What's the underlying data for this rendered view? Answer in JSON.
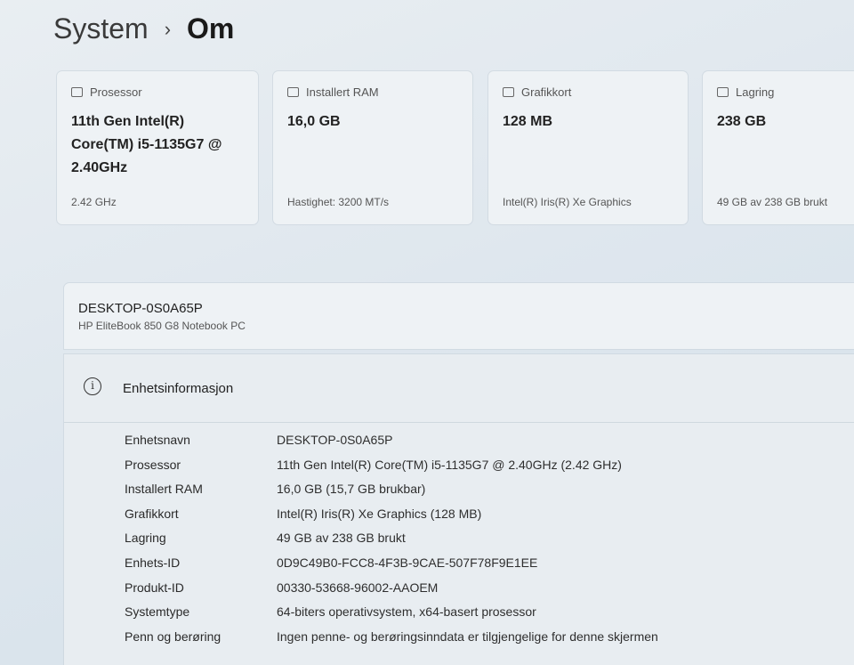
{
  "breadcrumb": {
    "root": "System",
    "separator": "›",
    "current": "Om"
  },
  "cards": [
    {
      "key": "processor",
      "label": "Prosessor",
      "icon": "cpu-icon",
      "value": "11th Gen Intel(R) Core(TM) i5-1135G7 @ 2.40GHz",
      "sub": "2.42 GHz"
    },
    {
      "key": "ram",
      "label": "Installert RAM",
      "icon": "ram-icon",
      "value": "16,0 GB",
      "sub": "Hastighet: 3200 MT/s"
    },
    {
      "key": "gpu",
      "label": "Grafikkort",
      "icon": "gpu-icon",
      "value": "128 MB",
      "sub": "Intel(R) Iris(R) Xe Graphics"
    },
    {
      "key": "storage",
      "label": "Lagring",
      "icon": "storage-icon",
      "value": "238 GB",
      "sub": "49 GB av 238 GB brukt"
    }
  ],
  "device": {
    "name": "DESKTOP-0S0A65P",
    "model": "HP EliteBook 850 G8 Notebook PC"
  },
  "info": {
    "title": "Enhetsinformasjon",
    "icon": "info-icon",
    "rows": [
      {
        "key": "Enhetsnavn",
        "value": "DESKTOP-0S0A65P"
      },
      {
        "key": "Prosessor",
        "value": "11th Gen Intel(R) Core(TM) i5-1135G7 @ 2.40GHz (2.42 GHz)"
      },
      {
        "key": "Installert RAM",
        "value": "16,0 GB (15,7 GB brukbar)"
      },
      {
        "key": "Grafikkort",
        "value": "Intel(R) Iris(R) Xe Graphics (128 MB)"
      },
      {
        "key": "Lagring",
        "value": "49 GB av 238 GB brukt"
      },
      {
        "key": "Enhets-ID",
        "value": "0D9C49B0-FCC8-4F3B-9CAE-507F78F9E1EE"
      },
      {
        "key": "Produkt-ID",
        "value": "00330-53668-96002-AAOEM"
      },
      {
        "key": "Systemtype",
        "value": "64-biters operativsystem, x64-basert prosessor"
      },
      {
        "key": "Penn og berøring",
        "value": "Ingen penne- og berøringsinndata er tilgjengelige for denne skjermen"
      }
    ]
  }
}
